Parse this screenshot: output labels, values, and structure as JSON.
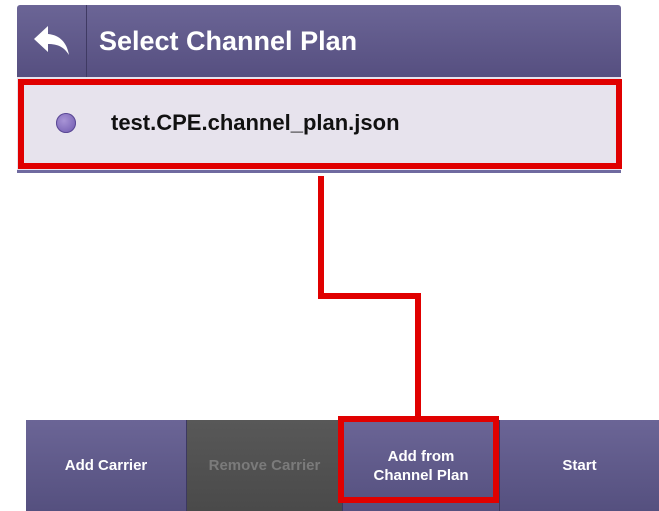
{
  "header": {
    "back_icon": "back-arrow-icon",
    "title": "Select Channel Plan"
  },
  "channel_plans": {
    "items": [
      {
        "label": "test.CPE.channel_plan.json",
        "selected": true
      }
    ]
  },
  "bottom_bar": {
    "add_carrier": "Add Carrier",
    "remove_carrier": "Remove Carrier",
    "add_from_line1": "Add from",
    "add_from_line2": "Channel Plan",
    "start": "Start"
  },
  "colors": {
    "header": "#5e5889",
    "highlight": "#e00000",
    "list_background": "#e7e3ed",
    "disabled_button": "#515151"
  }
}
